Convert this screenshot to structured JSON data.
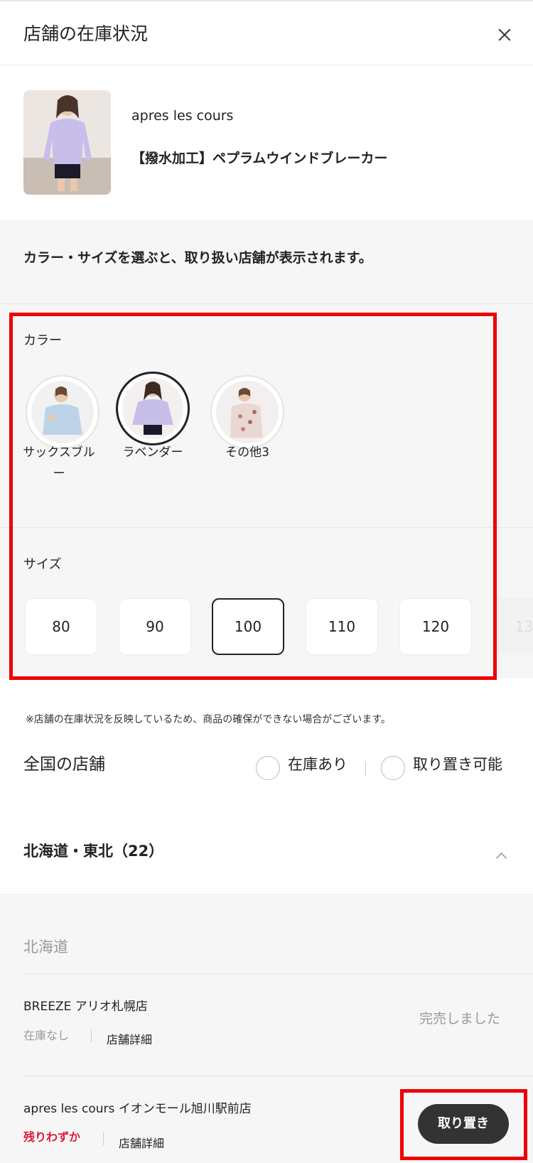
{
  "header": {
    "title": "店舗の在庫状況",
    "close_icon": "close-icon"
  },
  "product": {
    "brand": "apres les cours",
    "name": "【撥水加工】ペプラムウインドブレーカー"
  },
  "selection": {
    "hint": "カラー・サイズを選ぶと、取り扱い店舗が表示されます。",
    "color_label": "カラー",
    "colors": [
      {
        "name": "サックスブルー",
        "selected": false
      },
      {
        "name": "ラベンダー",
        "selected": true
      },
      {
        "name": "その他3",
        "selected": false
      }
    ],
    "size_label": "サイズ",
    "sizes": [
      "80",
      "90",
      "100",
      "110",
      "120",
      "13"
    ],
    "selected_size": "100"
  },
  "note": "※店舗の在庫状況を反映しているため、商品の確保ができない場合がございます。",
  "stores": {
    "title": "全国の店舗",
    "filters": [
      "在庫あり",
      "取り置き可能"
    ],
    "region": "北海道・東北（22）",
    "prefecture": "北海道",
    "list": [
      {
        "name": "BREEZE アリオ札幌店",
        "status": "在庫なし",
        "detail": "店舗詳細",
        "action": "完売しました"
      },
      {
        "name": "apres les cours イオンモール旭川駅前店",
        "status": "残りわずか",
        "detail": "店舗詳細",
        "action": "取り置き"
      }
    ]
  },
  "colors": {
    "accent": "#ee0000",
    "low_stock": "#e0173b",
    "dark_button": "#333333",
    "panel_bg": "#f6f6f6"
  }
}
